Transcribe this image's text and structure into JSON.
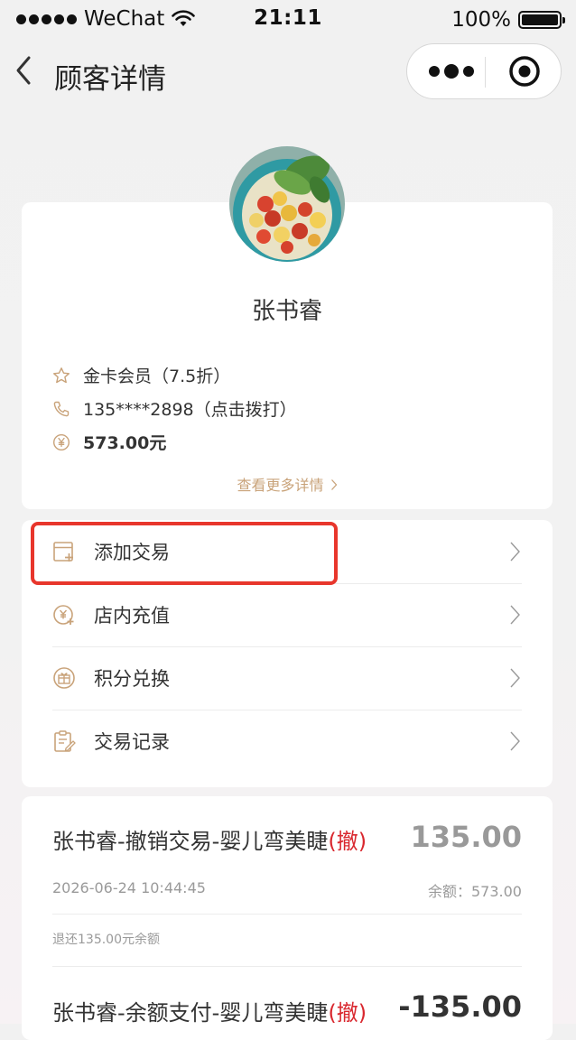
{
  "status_bar": {
    "carrier": "WeChat",
    "time": "21:11",
    "battery": "100%",
    "battery_level": 1.0
  },
  "nav": {
    "title": "顾客详情",
    "icons": {
      "back": "chevron-left-icon",
      "more": "more-dots-icon",
      "close": "target-close-icon"
    }
  },
  "customer": {
    "name": "张书睿",
    "membership": "金卡会员（7.5折）",
    "phone": "135****2898（点击拨打）",
    "balance": "573.00元",
    "more_details": "查看更多详情",
    "icons": {
      "membership": "star-icon",
      "phone": "phone-icon",
      "balance": "yen-coin-icon"
    }
  },
  "menu": {
    "items": [
      {
        "label": "添加交易",
        "icon": "add-transaction-icon"
      },
      {
        "label": "店内充值",
        "icon": "recharge-icon"
      },
      {
        "label": "积分兑换",
        "icon": "gift-icon"
      },
      {
        "label": "交易记录",
        "icon": "clipboard-icon"
      }
    ]
  },
  "transactions": [
    {
      "title": "张书睿-撤销交易-婴儿弯美睫",
      "badge": "(撤)",
      "amount": "135.00",
      "date": "2026-06-24 10:44:45",
      "balance": "余额：573.00",
      "note": "退还135.00元余额"
    },
    {
      "title": "张书睿-余额支付-婴儿弯美睫",
      "badge": "(撤)",
      "amount": "-135.00"
    }
  ],
  "colors": {
    "accent_gold": "#c9a37a",
    "revoke_red": "#d9282f",
    "highlight_red": "#e8362c",
    "background": "#f1f1f1"
  }
}
